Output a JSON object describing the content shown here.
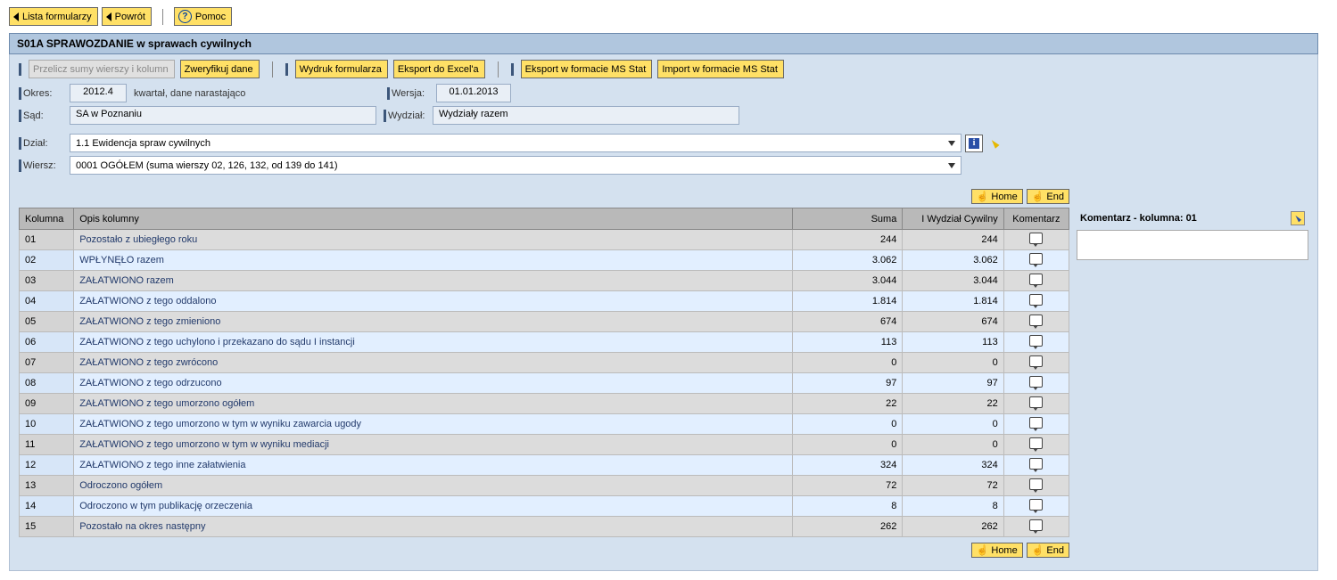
{
  "topbar": {
    "lista_formularzy": "Lista formularzy",
    "powrot": "Powrót",
    "pomoc": "Pomoc"
  },
  "header": {
    "title": "S01A SPRAWOZDANIE w sprawach cywilnych"
  },
  "toolbar": {
    "przelicz": "Przelicz sumy wierszy i kolumn",
    "zweryfikuj": "Zweryfikuj dane",
    "wydruk": "Wydruk formularza",
    "ekspexcel": "Eksport do Excel'a",
    "ekspmsstat": "Eksport w formacie MS Stat",
    "impmsstat": "Import w formacie MS Stat"
  },
  "form": {
    "okres_label": "Okres:",
    "okres_value": "2012.4",
    "okres_suffix": "kwartał, dane narastająco",
    "wersja_label": "Wersja:",
    "wersja_value": "01.01.2013",
    "sad_label": "Sąd:",
    "sad_value": "SA w Poznaniu",
    "wydzial_label": "Wydział:",
    "wydzial_value": "Wydziały razem",
    "dzial_label": "Dział:",
    "dzial_value": "1.1 Ewidencja spraw cywilnych",
    "wiersz_label": "Wiersz:",
    "wiersz_value": "0001 OGÓŁEM (suma wierszy 02, 126, 132, od 139 do 141)"
  },
  "nav": {
    "home": "Home",
    "end": "End"
  },
  "table": {
    "columns": {
      "kolumna": "Kolumna",
      "opis": "Opis kolumny",
      "suma": "Suma",
      "wydzial1": "I Wydział Cywilny",
      "komentarz": "Komentarz"
    },
    "rows": [
      {
        "k": "01",
        "opis": "Pozostało z ubiegłego roku",
        "suma": "244",
        "w1": "244"
      },
      {
        "k": "02",
        "opis": "WPŁYNĘŁO razem",
        "suma": "3.062",
        "w1": "3.062"
      },
      {
        "k": "03",
        "opis": "ZAŁATWIONO razem",
        "suma": "3.044",
        "w1": "3.044"
      },
      {
        "k": "04",
        "opis": "ZAŁATWIONO z tego oddalono",
        "suma": "1.814",
        "w1": "1.814"
      },
      {
        "k": "05",
        "opis": "ZAŁATWIONO z tego zmieniono",
        "suma": "674",
        "w1": "674"
      },
      {
        "k": "06",
        "opis": "ZAŁATWIONO z tego uchylono i przekazano do sądu I instancji",
        "suma": "113",
        "w1": "113"
      },
      {
        "k": "07",
        "opis": "ZAŁATWIONO z tego zwrócono",
        "suma": "0",
        "w1": "0"
      },
      {
        "k": "08",
        "opis": "ZAŁATWIONO z tego odrzucono",
        "suma": "97",
        "w1": "97"
      },
      {
        "k": "09",
        "opis": "ZAŁATWIONO z tego umorzono ogółem",
        "suma": "22",
        "w1": "22"
      },
      {
        "k": "10",
        "opis": "ZAŁATWIONO z tego umorzono w tym w wyniku zawarcia ugody",
        "suma": "0",
        "w1": "0"
      },
      {
        "k": "11",
        "opis": "ZAŁATWIONO z tego umorzono w tym w wyniku mediacji",
        "suma": "0",
        "w1": "0"
      },
      {
        "k": "12",
        "opis": "ZAŁATWIONO z tego inne załatwienia",
        "suma": "324",
        "w1": "324"
      },
      {
        "k": "13",
        "opis": "Odroczono ogółem",
        "suma": "72",
        "w1": "72"
      },
      {
        "k": "14",
        "opis": "Odroczono w tym publikację orzeczenia",
        "suma": "8",
        "w1": "8"
      },
      {
        "k": "15",
        "opis": "Pozostało na okres następny",
        "suma": "262",
        "w1": "262"
      }
    ]
  },
  "comment": {
    "title": "Komentarz - kolumna: 01",
    "text": ""
  }
}
